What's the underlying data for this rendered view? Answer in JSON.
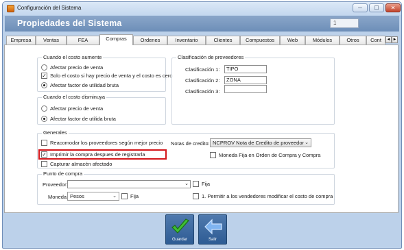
{
  "window": {
    "title": "Configuración del Sistema",
    "controls": [
      "─",
      "☐",
      "✕"
    ]
  },
  "header": {
    "title": "Propiedades del Sistema",
    "value": "1"
  },
  "tabs": [
    "Empresa",
    "Ventas",
    "FEA",
    "Compras",
    "Ordenes",
    "Inventario",
    "Clientes",
    "Compuestos",
    "Web",
    "Módulos",
    "Otros",
    "Cont"
  ],
  "tab_scroll": {
    "left": "◄",
    "right": "►"
  },
  "costo_aumente": {
    "title": "Cuando el costo aumente",
    "options": [
      "Afectar precio de venta",
      "Solo el costo si hay precio de venta y el costo es cero",
      "Afectar factor de utilidad bruta"
    ]
  },
  "costo_disminuya": {
    "title": "Cuando el costo disminuya",
    "options": [
      "Afectar precio de venta",
      "Afectar factor de utilida bruta"
    ]
  },
  "clasificacion": {
    "title": "Clasificación de proveedores",
    "labels": [
      "Clasificación 1:",
      "Clasificación 2:",
      "Clasificación 3:"
    ],
    "values": [
      "TIPO",
      "ZONA",
      ""
    ]
  },
  "generales": {
    "title": "Generales",
    "options": [
      "Reacomodar los proveedores según mejor precio",
      "Imprimir la compra despues de registrarla",
      "Capturar almacén afectado"
    ],
    "notas_label": "Notas de credito:",
    "notas_value": "NCPROV Nota de Credito de proveedor",
    "moneda_fija": "Moneda Fija en Orden de Compra y Compra"
  },
  "punto_compra": {
    "title": "Punto de compra",
    "proveedor_label": "Proveedor:",
    "proveedor_value": "",
    "fija": "Fija",
    "moneda_label": "Moneda:",
    "moneda_value": "Pesos",
    "fija2": "Fija",
    "permitir": "1. Permitir a los vendedores modificar el costo de compra"
  },
  "buttons": {
    "guardar": "Guardar",
    "salir": "Salir"
  },
  "colors": {
    "accent": "#2e5c94",
    "highlight": "#d4161a",
    "window_bg": "#bcd1ea"
  }
}
